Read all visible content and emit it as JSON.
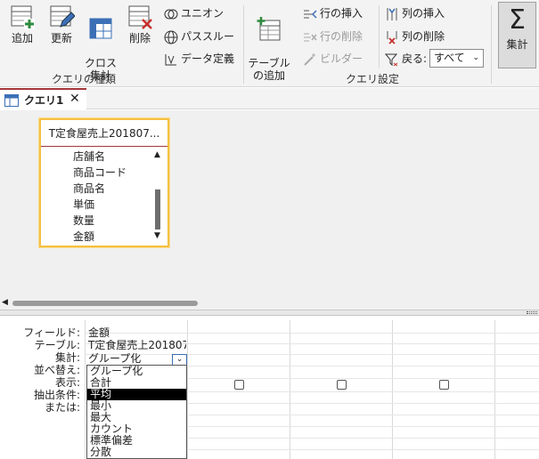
{
  "ribbon": {
    "query_type": {
      "append": "追加",
      "update": "更新",
      "crosstab": "クロス\n集計",
      "delete": "削除",
      "union": "ユニオン",
      "passthrough": "パススルー",
      "data_definition": "データ定義",
      "group_label": "クエリの種類"
    },
    "query_setup": {
      "add_table": "テーブル\nの追加",
      "insert_row": "行の挿入",
      "delete_row": "行の削除",
      "builder": "ビルダー",
      "insert_column": "列の挿入",
      "delete_column": "列の削除",
      "return_label": "戻る:",
      "return_value": "すべて",
      "group_label": "クエリ設定"
    },
    "totals": "集計"
  },
  "tab": {
    "label": "クエリ1"
  },
  "table": {
    "title": "T定食屋売上201807...",
    "fields": [
      "店舗名",
      "商品コード",
      "商品名",
      "単価",
      "数量",
      "金額"
    ]
  },
  "grid": {
    "row_labels": [
      "フィールド:",
      "テーブル:",
      "集計:",
      "並べ替え:",
      "表示:",
      "抽出条件:",
      "または:"
    ],
    "field": "金額",
    "table": "T定食屋売上2018070",
    "total": "グループ化"
  },
  "dropdown": {
    "options": [
      "グループ化",
      "合計",
      "平均",
      "最小",
      "最大",
      "カウント",
      "標準偏差",
      "分散"
    ],
    "selected": "平均"
  },
  "colors": {
    "accent": "#a4373a",
    "table_border": "#f5c042"
  }
}
